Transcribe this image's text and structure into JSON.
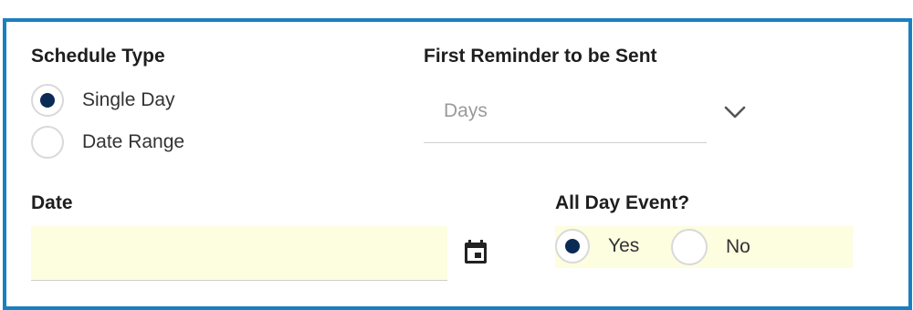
{
  "schedule": {
    "label": "Schedule Type",
    "options": [
      {
        "label": "Single Day",
        "selected": true
      },
      {
        "label": "Date Range",
        "selected": false
      }
    ]
  },
  "reminder": {
    "label": "First Reminder to be Sent",
    "value": "Days",
    "icon": "chevron-down-icon"
  },
  "date": {
    "label": "Date",
    "value": "",
    "icon": "calendar-icon"
  },
  "all_day": {
    "label": "All Day Event?",
    "options": [
      {
        "label": "Yes",
        "selected": true
      },
      {
        "label": "No",
        "selected": false
      }
    ]
  },
  "colors": {
    "border": "#1a7fc1",
    "radio_selected": "#0b2a55",
    "highlight_bg": "#fdfde0"
  }
}
